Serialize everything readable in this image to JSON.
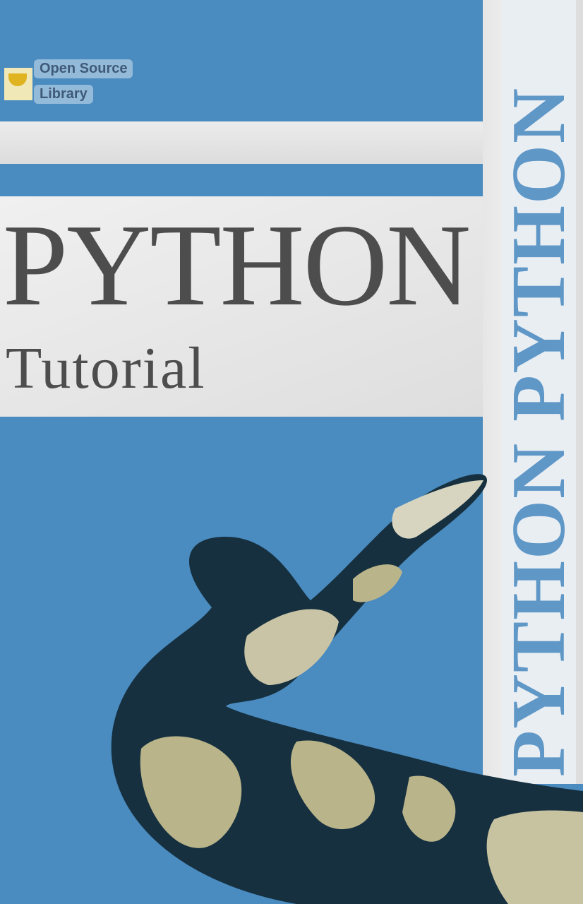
{
  "cover": {
    "title": "PYTHON",
    "subtitle": "Tutorial",
    "spine_text": "PYTHON PYTHON",
    "publisher_line1": "Open Source",
    "publisher_line2": "Library"
  },
  "colors": {
    "background": "#4a8bc0",
    "band": "#e4e4e4",
    "title": "#4d4d4d",
    "spine_text": "#5f97c7",
    "snake_dark": "#16303f",
    "snake_light": "#b9b48a"
  },
  "icons": {
    "logo": "publisher-bird-logo"
  }
}
